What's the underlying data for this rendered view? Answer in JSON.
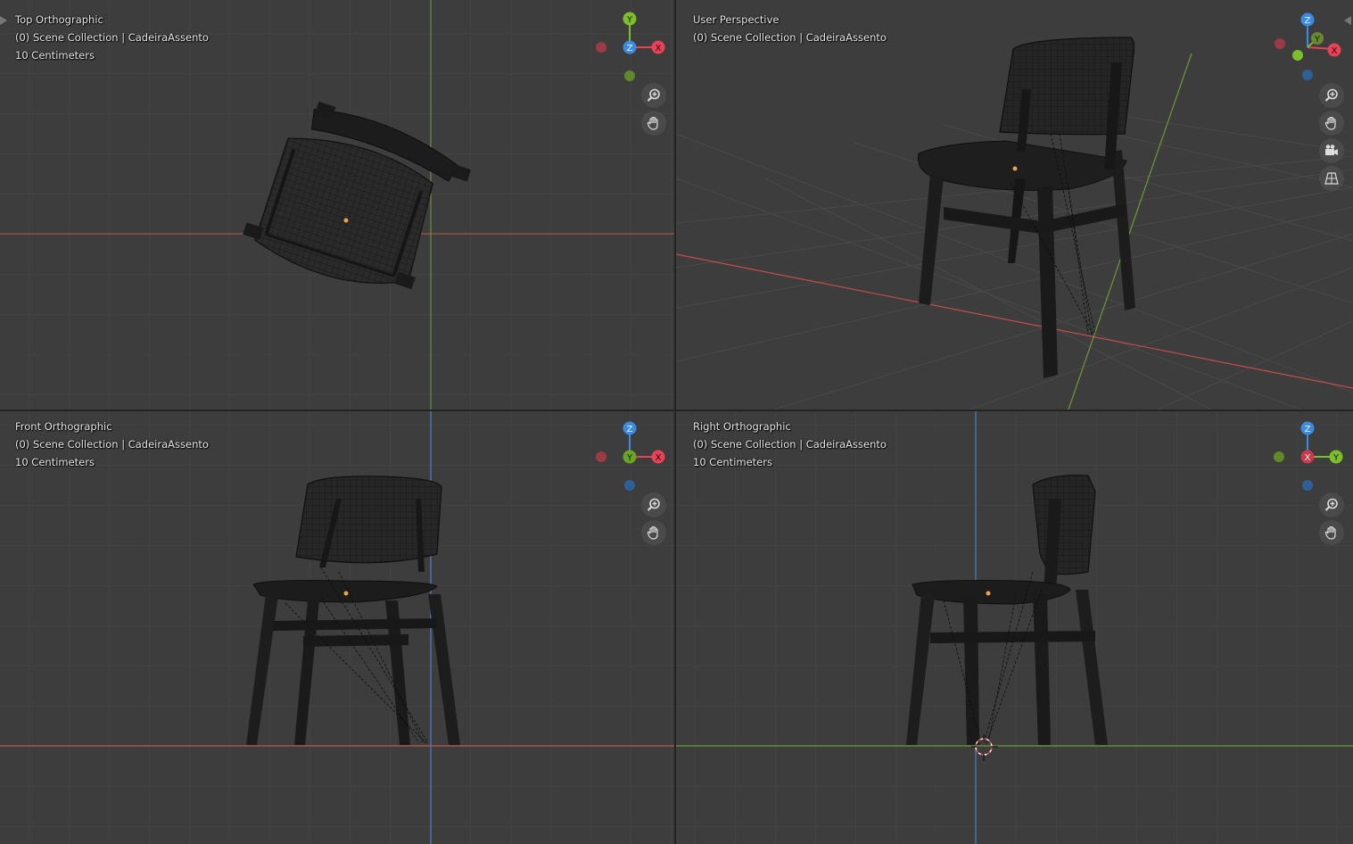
{
  "viewports": {
    "top_left": {
      "view": "Top Orthographic",
      "collection": "(0) Scene Collection | CadeiraAssento",
      "scale": "10 Centimeters"
    },
    "top_right": {
      "view": "User Perspective",
      "collection": "(0) Scene Collection | CadeiraAssento",
      "scale": ""
    },
    "bottom_left": {
      "view": "Front Orthographic",
      "collection": "(0) Scene Collection | CadeiraAssento",
      "scale": "10 Centimeters"
    },
    "bottom_right": {
      "view": "Right Orthographic",
      "collection": "(0) Scene Collection | CadeiraAssento",
      "scale": "10 Centimeters"
    }
  },
  "gizmo_labels": {
    "x": "X",
    "y": "Y",
    "z": "Z"
  },
  "colors": {
    "viewport_bg": "#3d3d3d",
    "grid_line": "#464646",
    "axis_x": "#d9524f",
    "axis_y": "#7ea33a",
    "axis_z": "#4c7ec9",
    "gizmo_x": "#e84256",
    "gizmo_y": "#7cbf2a",
    "gizmo_z": "#3b8ce0",
    "mesh": "#1a1a1a",
    "wire": "#0f0f0f",
    "origin_dot": "#f0a04b"
  },
  "icons": [
    "zoom-icon",
    "hand-pan-icon",
    "camera-icon",
    "grid-ortho-icon"
  ]
}
